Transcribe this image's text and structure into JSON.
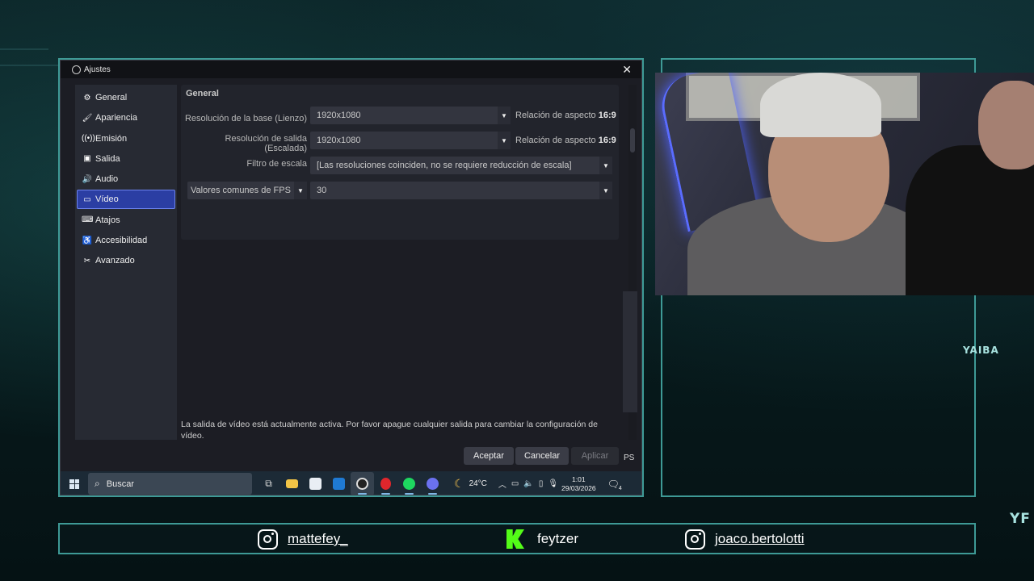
{
  "window": {
    "title": "Ajustes",
    "close_label": "✕"
  },
  "sidebar": {
    "items": [
      {
        "label": "General",
        "icon": "gear-icon",
        "glyph": "⚙"
      },
      {
        "label": "Apariencia",
        "icon": "palette-icon",
        "glyph": "🖌"
      },
      {
        "label": "Emisión",
        "icon": "broadcast-icon",
        "glyph": "((•))"
      },
      {
        "label": "Salida",
        "icon": "output-icon",
        "glyph": "▣"
      },
      {
        "label": "Audio",
        "icon": "speaker-icon",
        "glyph": "🔊"
      },
      {
        "label": "Vídeo",
        "icon": "monitor-icon",
        "glyph": "▭"
      },
      {
        "label": "Atajos",
        "icon": "keyboard-icon",
        "glyph": "⌨"
      },
      {
        "label": "Accesibilidad",
        "icon": "accessibility-icon",
        "glyph": "♿"
      },
      {
        "label": "Avanzado",
        "icon": "tools-icon",
        "glyph": "✂"
      }
    ],
    "active_index": 5
  },
  "video": {
    "group_title": "General",
    "base_resolution_label": "Resolución de la base (Lienzo)",
    "base_resolution_value": "1920x1080",
    "base_aspect_prefix": "Relación de aspecto",
    "base_aspect_value": "16:9",
    "output_resolution_label": "Resolución de salida (Escalada)",
    "output_resolution_value": "1920x1080",
    "output_aspect_prefix": "Relación de aspecto",
    "output_aspect_value": "16:9",
    "scale_filter_label": "Filtro de escala",
    "scale_filter_value": "[Las resoluciones coinciden, no se requiere reducción de escala]",
    "fps_label": "Valores comunes de FPS",
    "fps_value": "30",
    "notice": "La salida de vídeo está actualmente activa. Por favor apague cualquier salida para cambiar la configuración de vídeo."
  },
  "buttons": {
    "accept": "Aceptar",
    "cancel": "Cancelar",
    "apply": "Aplicar"
  },
  "taskbar": {
    "search_placeholder": "Buscar",
    "weather_temp": "24°C",
    "time": "1:01",
    "date": "29/03/2026",
    "notification_count": "4"
  },
  "obs_peek": {
    "partial_label": "PS"
  },
  "background": {
    "sign_text_1": "YAIBA",
    "sign_text_2": "YF"
  },
  "social": {
    "instagram_1": "mattefey_",
    "kick": "feytzer",
    "instagram_2": "joaco.bertolotti",
    "kick_color": "#53fc18"
  },
  "colors": {
    "accent_frame": "#3e9a96",
    "active_nav": "#2b3ea3"
  }
}
